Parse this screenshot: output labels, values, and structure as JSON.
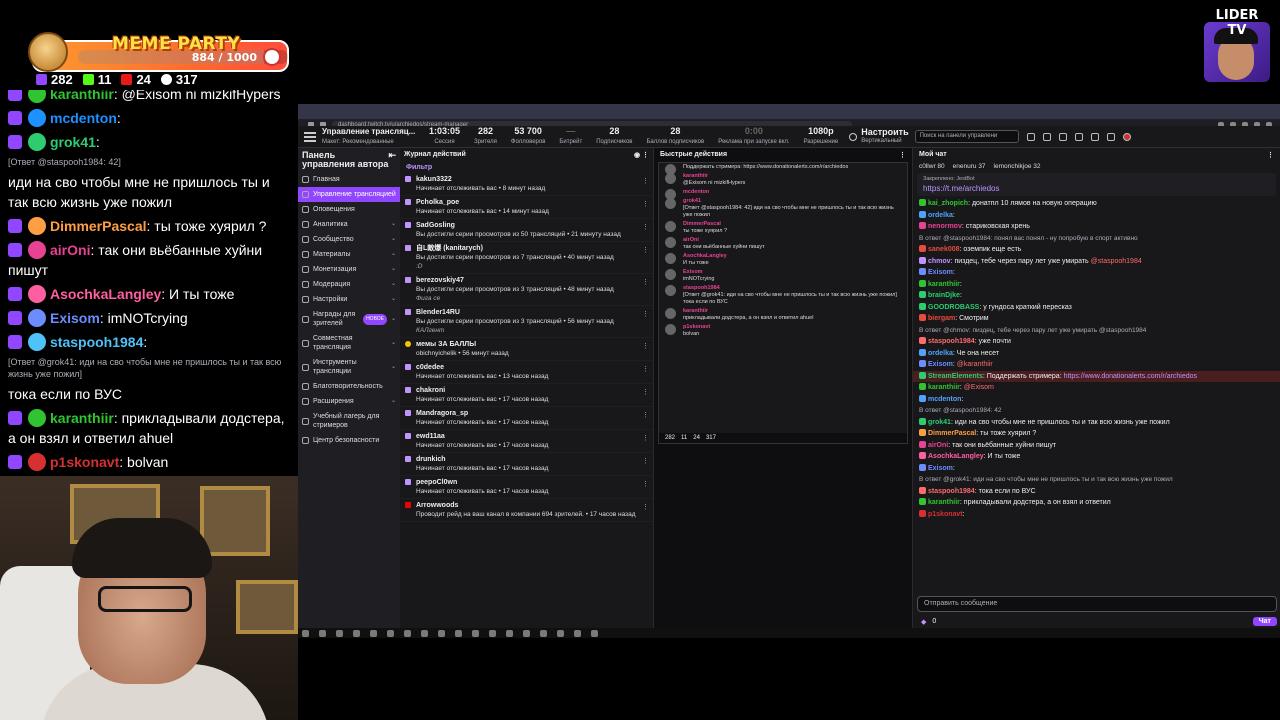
{
  "overlay": {
    "meme_party": {
      "title": "MEME PARTY",
      "count": "884 / 1000",
      "progress": 0.884
    },
    "stats": {
      "tw": "282",
      "kick": "11",
      "yt": "24",
      "people": "317"
    },
    "lider_tv": "LIDER TV"
  },
  "left_chat": [
    {
      "type": "cut",
      "name": "karanthiir",
      "text": ": @Exisom ni mizkifHypers",
      "color": "#31c431"
    },
    {
      "type": "msg",
      "name": "mcdenton",
      "text": ":",
      "color": "#1e90ff"
    },
    {
      "type": "msg",
      "name": "grok41",
      "text": ":",
      "color": "#2ecc71"
    },
    {
      "type": "ref",
      "text": "[Ответ @staspooh1984: 42]"
    },
    {
      "type": "plain",
      "text": "иди на сво чтобы мне не пришлось ты и так всю жизнь уже пожил"
    },
    {
      "type": "msg",
      "name": "DimmerPascal",
      "text": ": ты тоже хуярил ?",
      "color": "#ff9f43"
    },
    {
      "type": "msg",
      "name": "airOni",
      "text": ": так они вьёбанные хуйни пишут",
      "color": "#e84393"
    },
    {
      "type": "msg",
      "name": "AsochkaLangley",
      "text": ": И ты тоже",
      "color": "#ff5ea0"
    },
    {
      "type": "msg",
      "name": "Exisom",
      "text": ": imNOTcrying",
      "color": "#6c8cff"
    },
    {
      "type": "msg",
      "name": "staspooh1984",
      "text": ":",
      "color": "#4fc3f7"
    },
    {
      "type": "ref",
      "text": "[Ответ @grok41: иди на сво чтобы мне не пришлось ты и так всю жизнь уже пожил]"
    },
    {
      "type": "plain",
      "text": "тока если по ВУС"
    },
    {
      "type": "msg",
      "name": "karanthiir",
      "text": ": прикладывали додстера, а он взял и ответил ahuel",
      "color": "#31c431"
    },
    {
      "type": "msg",
      "name": "p1skonavt",
      "text": ": bolvan",
      "color": "#d63031"
    }
  ],
  "browser": {
    "url": "dashboard.twitch.tv/u/archiedos/stream-manager",
    "header": {
      "title": "Управление трансляц...",
      "subtitle": "Макет: Рекомендованные",
      "stats": [
        {
          "value": "1:03:05",
          "label": "Сессия"
        },
        {
          "value": "282",
          "label": "Зрителя"
        },
        {
          "value": "53 700",
          "label": "Фолловеров"
        },
        {
          "value": "—",
          "label": "Битрейт"
        },
        {
          "value": "28",
          "label": "Подписчиков"
        },
        {
          "value": "28",
          "label": "Баллов подписчиков"
        },
        {
          "value": "0:00",
          "label": "Реклама при запуске вкл."
        },
        {
          "value": "1080p",
          "label": "Разрешение"
        }
      ],
      "configure": "Настроить",
      "configure_sub": "Вертикальный",
      "search_placeholder": "Поиск на панели управлени"
    },
    "sidenav": {
      "title": "Панель управления автора",
      "items": [
        {
          "label": "Главная",
          "chev": ""
        },
        {
          "label": "Управление трансляцией",
          "chev": "",
          "active": true
        },
        {
          "label": "Оповещения",
          "chev": ""
        },
        {
          "label": "Аналитика",
          "chev": "⌄"
        },
        {
          "label": "Сообщество",
          "chev": "⌄"
        },
        {
          "label": "Материалы",
          "chev": "⌄"
        },
        {
          "label": "Монетизация",
          "chev": "⌄"
        },
        {
          "label": "Модерация",
          "chev": "⌄"
        },
        {
          "label": "Настройки",
          "chev": "⌄"
        },
        {
          "label": "Награды для зрителей",
          "chev": "⌄",
          "badge": "НОВОЕ"
        },
        {
          "label": "Совместная трансляция",
          "chev": "⌄"
        },
        {
          "label": "Инструменты трансляции",
          "chev": "⌄"
        },
        {
          "label": "Благотворительность",
          "chev": ""
        },
        {
          "label": "Расширения",
          "chev": "⌄"
        },
        {
          "label": "Учебный лагерь для стримеров",
          "chev": ""
        },
        {
          "label": "Центр безопасности",
          "chev": ""
        }
      ]
    },
    "activity": {
      "title": "Журнал действий",
      "filter": "Фильтр",
      "items": [
        {
          "name": "kakun3322",
          "sub": "Начинает отслеживать вас • 8 минут назад",
          "note": "",
          "ico": ""
        },
        {
          "name": "Pcholka_poe",
          "sub": "Начинает отслеживать вас • 14 минут назад",
          "note": "",
          "ico": ""
        },
        {
          "name": "SadGosling",
          "sub": "Вы достигли серии просмотров из 50 трансляций • 21 минуту назад",
          "note": "",
          "ico": ""
        },
        {
          "name": "自L敵爆 (kanitarych)",
          "sub": "Вы достигли серии просмотров из 7 трансляций • 40 минут назад",
          "note": ":D",
          "ico": ""
        },
        {
          "name": "berezovskiy47",
          "sub": "Вы достигли серии просмотров из 3 трансляций • 48 минут назад",
          "note": "Фига се",
          "ico": ""
        },
        {
          "name": "Blender14RU",
          "sub": "Вы достигли серии просмотров из 3 трансляций • 56 минут назад",
          "note": "КАЛгент",
          "ico": ""
        },
        {
          "name": "мемы ЗА БАЛЛЫ",
          "sub": "obichnyichelik • 56 минут назад",
          "note": "",
          "ico": "yel"
        },
        {
          "name": "c0dedee",
          "sub": "Начинает отслеживать вас • 13 часов назад",
          "note": "",
          "ico": ""
        },
        {
          "name": "chakroni",
          "sub": "Начинает отслеживать вас • 17 часов назад",
          "note": "",
          "ico": ""
        },
        {
          "name": "Mandragora_sp",
          "sub": "Начинает отслеживать вас • 17 часов назад",
          "note": "",
          "ico": ""
        },
        {
          "name": "ewd11aa",
          "sub": "Начинает отслеживать вас • 17 часов назад",
          "note": "",
          "ico": ""
        },
        {
          "name": "drunkich",
          "sub": "Начинает отслеживать вас • 17 часов назад",
          "note": "",
          "ico": ""
        },
        {
          "name": "peepoCl0wn",
          "sub": "Начинает отслеживать вас • 17 часов назад",
          "note": "",
          "ico": ""
        },
        {
          "name": "Arrowwoods",
          "sub": "Проводит рейд на ваш канал в компании 694 зрителей. • 17 часов назад",
          "note": "",
          "ico": "red"
        }
      ]
    },
    "quick": {
      "title": "Быстрые действия",
      "popout_lines": [
        {
          "name": "",
          "text": "Поддержать стримера: https://www.donationalerts.com/r/archiedos"
        },
        {
          "name": "karanthiir",
          "text": "@Exisom ni mizkifHypers"
        },
        {
          "name": "mcdenton",
          "text": ""
        },
        {
          "name": "grok41",
          "text": "[Ответ @staspooh1984: 42] иди на сво чтобы мне не пришлось ты и так всю жизнь уже пожил"
        },
        {
          "name": "DimmerPascal",
          "text": "ты тоже хуярил ?"
        },
        {
          "name": "airOni",
          "text": "так они вьёбанные хуйни пишут"
        },
        {
          "name": "AsochkaLangley",
          "text": "И ты тоже"
        },
        {
          "name": "Exisom",
          "text": "imNOTcrying"
        },
        {
          "name": "staspooh1984",
          "text": "[Ответ @grok41: иди на сво чтобы мне не пришлось ты и так всю жизнь уже пожил] тока если по ВУС"
        },
        {
          "name": "karanthiir",
          "text": "прикладывали додстера, а он взял и ответил ahuel"
        },
        {
          "name": "p1skonavt",
          "text": "bolvan"
        }
      ],
      "footer": {
        "a": "282",
        "b": "11",
        "c": "24",
        "d": "317"
      }
    },
    "mychat": {
      "title": "Мой чат",
      "top": [
        "c0llwr 80",
        "enenuru 37",
        "lemonchikjoe 32"
      ],
      "pin_label": "Закреплено: JestBot",
      "pin_link": "https://t.me/archiedos",
      "lines": [
        {
          "name": "kai_zhopich",
          "text": ": донатпл 10 лямов на новую операцию",
          "color": "#31c431"
        },
        {
          "name": "ordelka",
          "text": ":",
          "color": "#4fa3ff"
        },
        {
          "name": "nenormov",
          "text": ": стариковская хрень",
          "color": "#e84393"
        },
        {
          "ref": "В ответ @staspooh1984: понял вас понял - ну попробую в спорт активно"
        },
        {
          "name": "sanek008",
          "text": ": оземпик еще есть",
          "color": "#e74c3c"
        },
        {
          "name": "chmov",
          "text": ": пиздец, тебе через пару лет уже умирать ",
          "color": "#bf94ff",
          "mention": "@staspooh1984"
        },
        {
          "name": "Exisom",
          "text": ":",
          "color": "#6c8cff"
        },
        {
          "name": "karanthiir",
          "text": ":",
          "color": "#31c431"
        },
        {
          "name": "brainDjke",
          "text": ":",
          "color": "#2ecc71"
        },
        {
          "name": "GOODROBASS",
          "text": ": у гундоса краткий пересказ",
          "color": "#2ecc71"
        },
        {
          "name": "biergam",
          "text": ": Смотрим",
          "color": "#e74c3c"
        },
        {
          "ref": "В ответ @chmov: пиздец, тебе через пару лет уже умирать @staspooh1984"
        },
        {
          "name": "staspooh1984",
          "text": ": уже почти",
          "color": "#ff6b6b"
        },
        {
          "name": "ordelka",
          "text": ": Че она несет",
          "color": "#4fa3ff"
        },
        {
          "name": "Exisom",
          "text": ": ",
          "color": "#6c8cff",
          "mention": "@karanthiir"
        },
        {
          "name": "StreamElements",
          "text": ": Поддержать стримера: ",
          "color": "#2ecc71",
          "link": "https://www.donationalerts.com/r/archiedos",
          "hl": true
        },
        {
          "name": "karanthiir",
          "text": ": ",
          "color": "#31c431",
          "mention": "@Exisom"
        },
        {
          "name": "mcdenton",
          "text": ":",
          "color": "#4fa3ff"
        },
        {
          "ref": "В ответ @staspooh1984: 42"
        },
        {
          "name": "grok41",
          "text": ": иди на сво чтобы мне не пришлось ты и так всю жизнь уже пожил",
          "color": "#2ecc71"
        },
        {
          "name": "DimmerPascal",
          "text": ": ты тоже хуярил ?",
          "color": "#ff9f43"
        },
        {
          "name": "airOni",
          "text": ": так они вьёбанные хуйни пишут",
          "color": "#e84393"
        },
        {
          "name": "AsochkaLangley",
          "text": ": И ты тоже",
          "color": "#ff5ea0"
        },
        {
          "name": "Exisom",
          "text": ":",
          "color": "#6c8cff"
        },
        {
          "ref": "В ответ @grok41: иди на сво чтобы мне не пришлось ты и так всю жизнь уже пожил"
        },
        {
          "name": "staspooh1984",
          "text": ": тока если по ВУС",
          "color": "#ff6b6b"
        },
        {
          "name": "karanthiir",
          "text": ": прикладывали додстера, а он взял и ответил",
          "color": "#31c431"
        },
        {
          "name": "p1skonavt",
          "text": ":",
          "color": "#d63031"
        }
      ],
      "input_placeholder": "Отправить сообщение",
      "points": "0",
      "send": "Чат"
    }
  },
  "colors": {
    "accent": "#9147ff",
    "panel": "#18181b",
    "bg": "#0e0e10"
  }
}
